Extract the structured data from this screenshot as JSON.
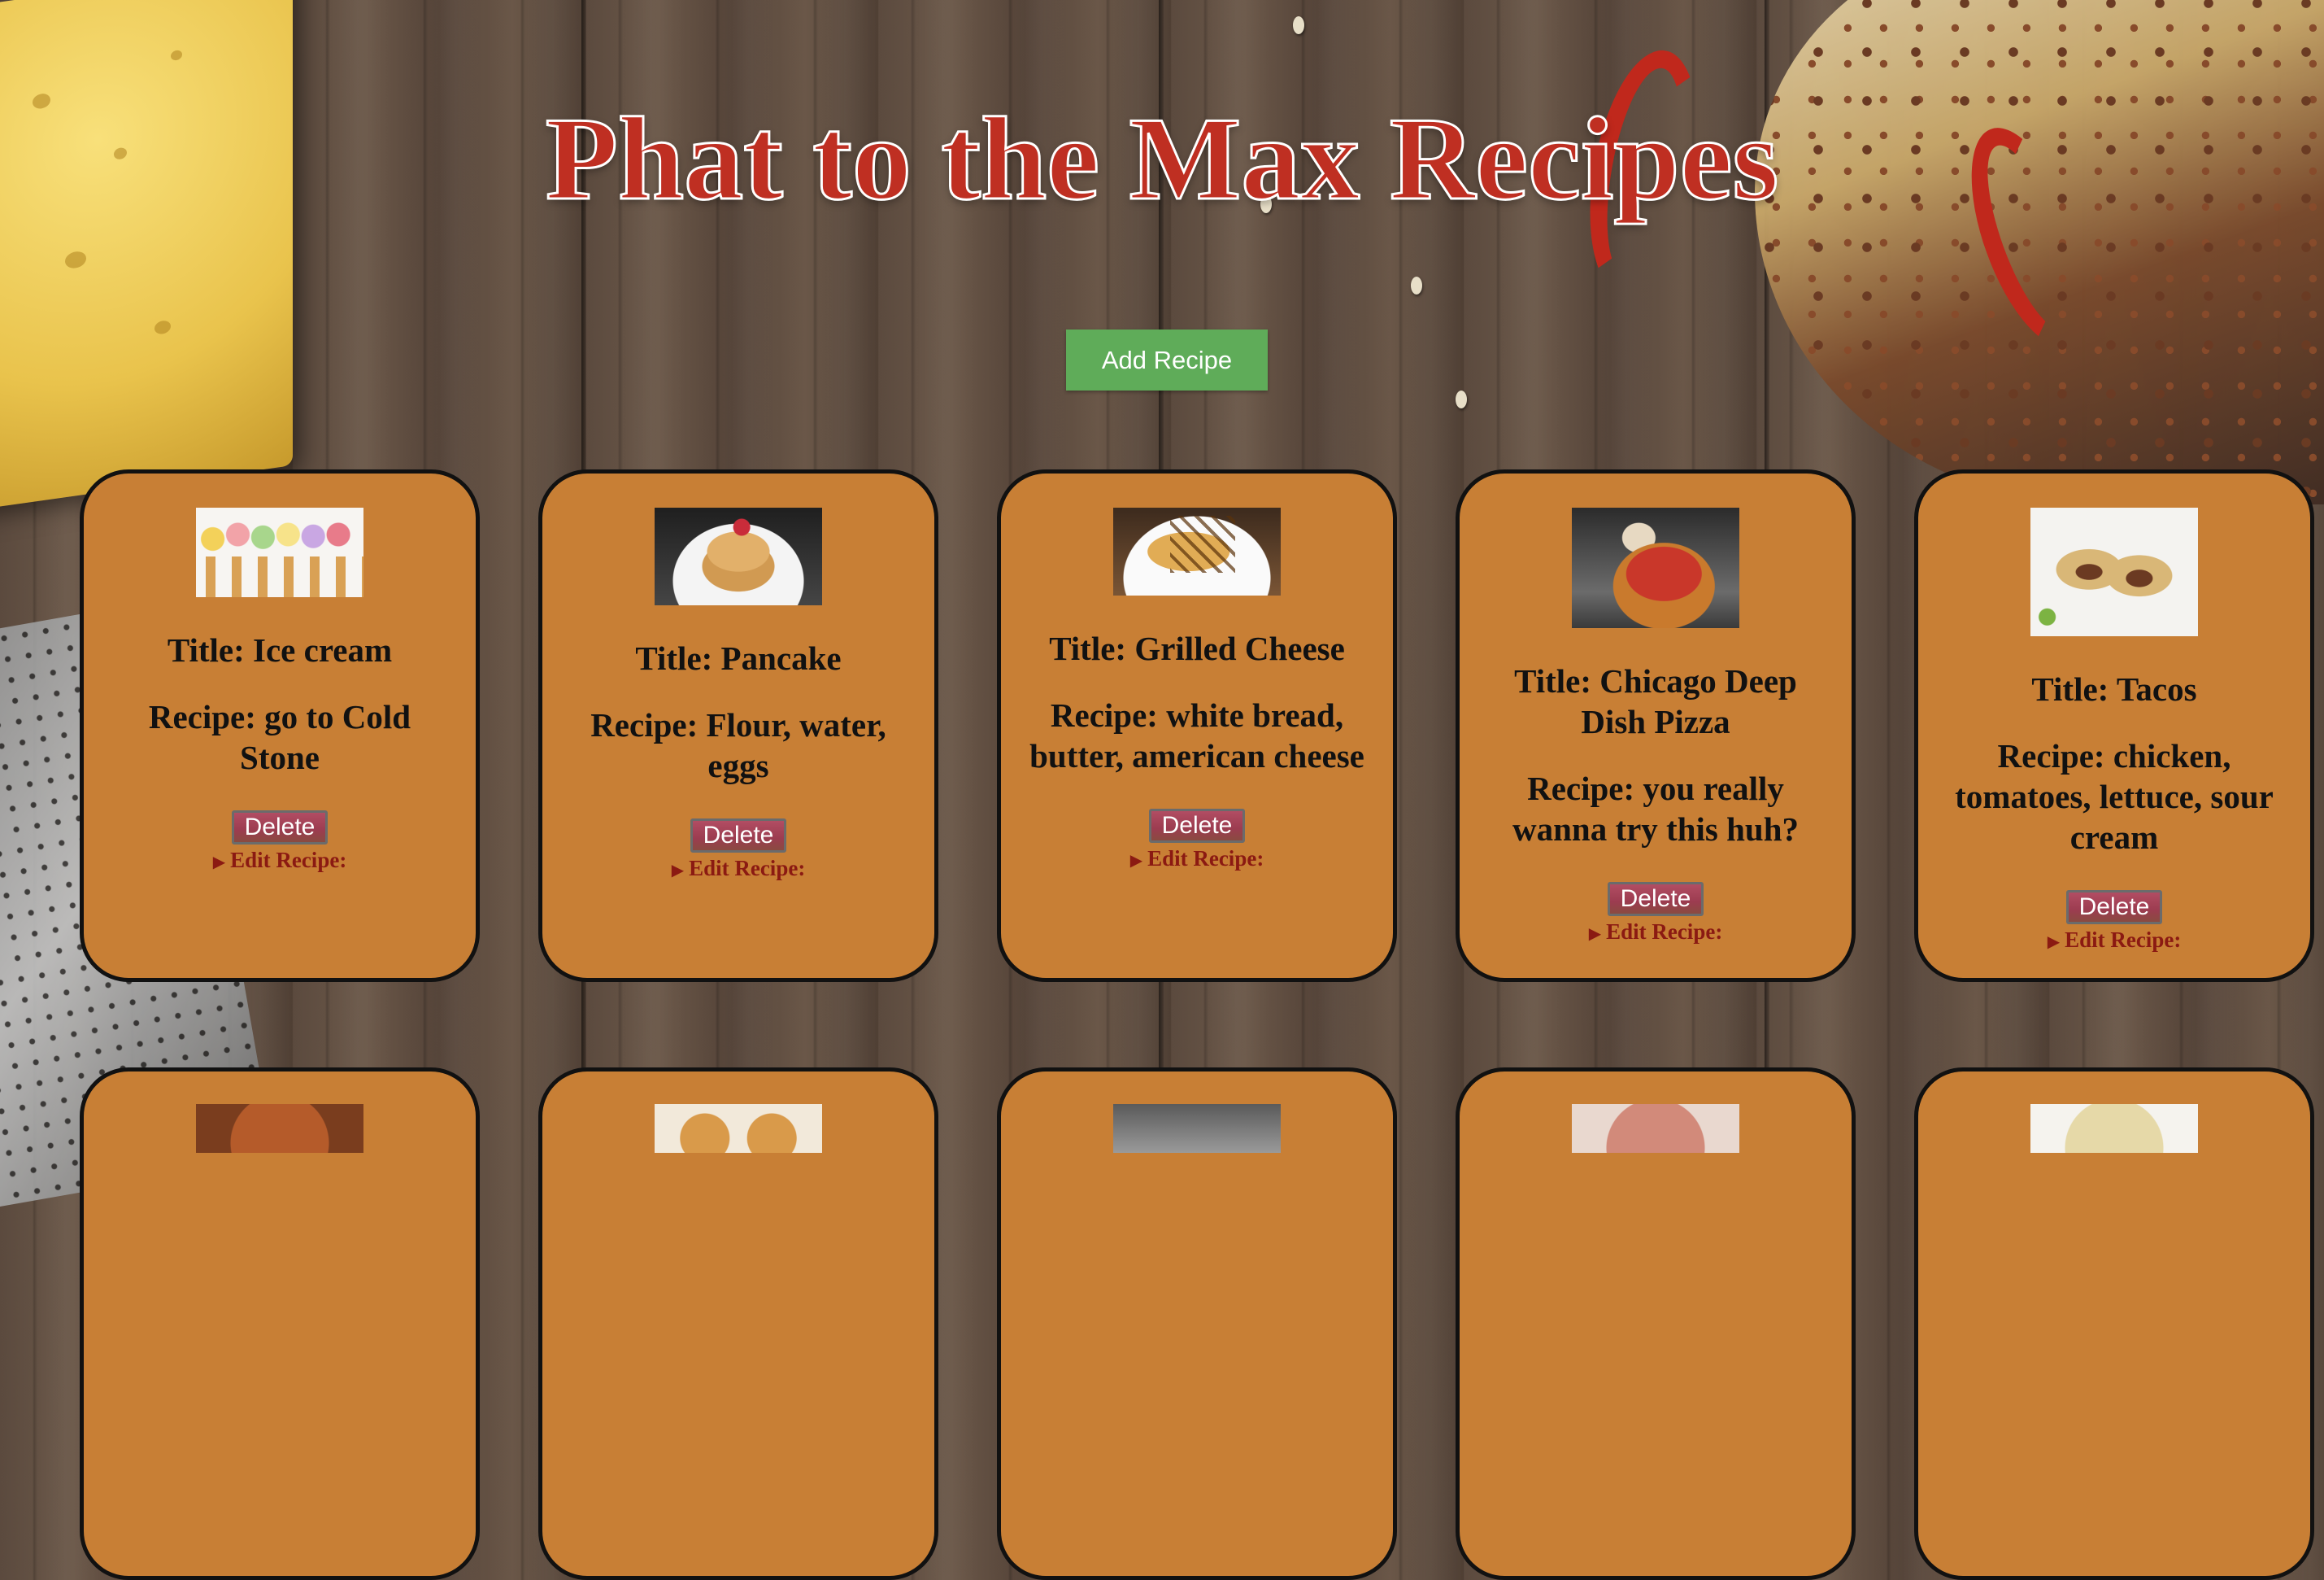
{
  "header": {
    "title": "Phat to the Max Recipes",
    "add_button_label": "Add Recipe"
  },
  "colors": {
    "title_red": "#bf2f22",
    "add_button_green": "#5fac59",
    "card_background": "#c87f35",
    "edit_link": "#8b1a12"
  },
  "recipes": [
    {
      "thumbnail": "ice-cream-cones-photo",
      "title": "Title: Ice cream",
      "recipe": "Recipe: go to Cold Stone",
      "delete_label": "Delete",
      "edit_label": "Edit Recipe:"
    },
    {
      "thumbnail": "pancake-stack-photo",
      "title": "Title: Pancake",
      "recipe": "Recipe: Flour, water, eggs",
      "delete_label": "Delete",
      "edit_label": "Edit Recipe:"
    },
    {
      "thumbnail": "grilled-cheese-photo",
      "title": "Title: Grilled Cheese",
      "recipe": "Recipe: white bread, butter, american cheese",
      "delete_label": "Delete",
      "edit_label": "Edit Recipe:"
    },
    {
      "thumbnail": "deep-dish-pizza-photo",
      "title": "Title: Chicago Deep Dish Pizza",
      "recipe": "Recipe: you really wanna try this huh?",
      "delete_label": "Delete",
      "edit_label": "Edit Recipe:"
    },
    {
      "thumbnail": "tacos-photo",
      "title": "Title: Tacos",
      "recipe": "Recipe: chicken, tomatoes, lettuce, sour cream",
      "delete_label": "Delete",
      "edit_label": "Edit Recipe:"
    }
  ],
  "second_row_thumbnails": [
    "paella-photo",
    "pastry-photo",
    "drink-photo",
    "dish-photo",
    "plate-photo"
  ]
}
